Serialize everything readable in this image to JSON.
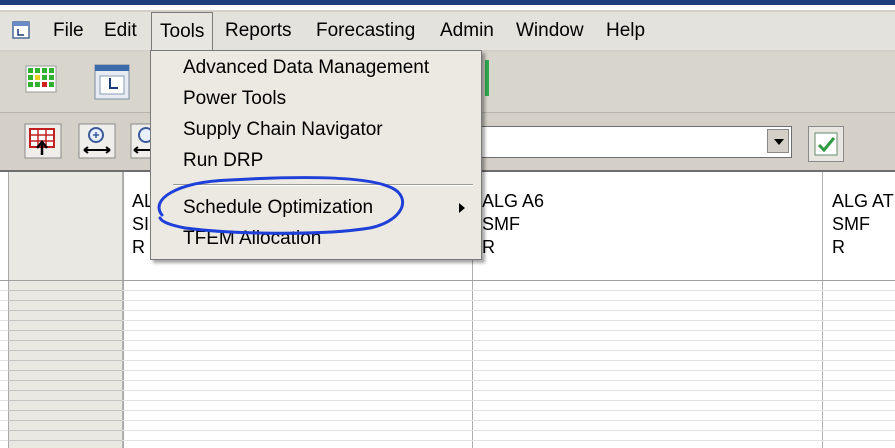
{
  "menubar": {
    "items": [
      {
        "id": "file",
        "label": "File"
      },
      {
        "id": "edit",
        "label": "Edit"
      },
      {
        "id": "tools",
        "label": "Tools"
      },
      {
        "id": "reports",
        "label": "Reports"
      },
      {
        "id": "forecasting",
        "label": "Forecasting"
      },
      {
        "id": "admin",
        "label": "Admin"
      },
      {
        "id": "window",
        "label": "Window"
      },
      {
        "id": "help",
        "label": "Help"
      }
    ],
    "open_menu": "Tools"
  },
  "tools_menu": {
    "items": [
      {
        "label": "Advanced Data Management"
      },
      {
        "label": "Power Tools"
      },
      {
        "label": "Supply Chain Navigator"
      },
      {
        "label": "Run DRP"
      },
      {
        "label": "Schedule Optimization",
        "has_submenu": true,
        "circled": true
      },
      {
        "label": "TFEM Allocation"
      }
    ]
  },
  "grid": {
    "columns": [
      {
        "line1": "AL",
        "line2": "SI",
        "line3": "R"
      },
      {
        "line1": "ALG A6",
        "line2": "SMF",
        "line3": "R"
      },
      {
        "line1": "ALG AT",
        "line2": "SMF",
        "line3": "R"
      }
    ]
  },
  "icons": {
    "app": "app-window-icon",
    "toolbar1": [
      "calendar-grid-icon",
      "schedule-icon"
    ],
    "toolbar2": [
      "grid-import-icon",
      "zoom-width-icon",
      "zoom-icon"
    ],
    "apply": "check-apply-icon"
  },
  "colors": {
    "annotation_circle": "#1e3fd8",
    "title_bar": "#1f3d7a"
  }
}
